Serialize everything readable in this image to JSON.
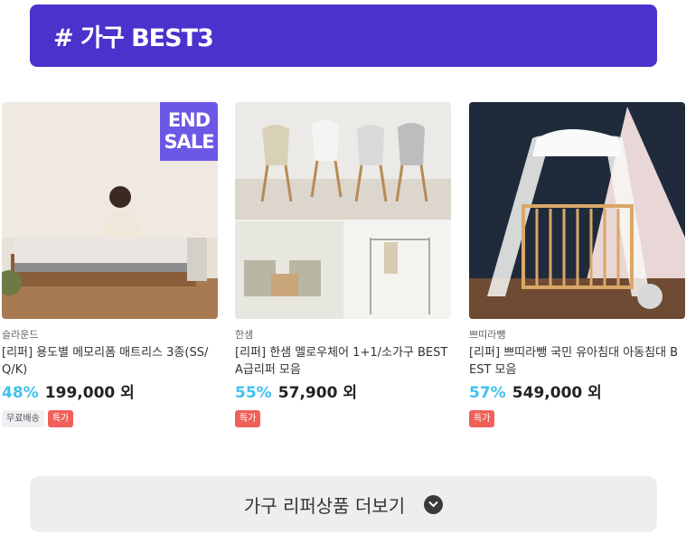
{
  "banner": {
    "title": "# 가구 BEST3"
  },
  "products": [
    {
      "seller": "슬라운드",
      "title": "[리퍼] 용도별 메모리폼 매트리스 3종(SS/Q/K)",
      "discount": "48%",
      "price": "199,000 외",
      "badge": [
        "END",
        "SALE"
      ],
      "tags": [
        "무료배송",
        "특가"
      ]
    },
    {
      "seller": "한샘",
      "title": "[리퍼] 한샘 멜로우체어 1+1/소가구 BEST A급리퍼 모음",
      "discount": "55%",
      "price": "57,900 외",
      "tags": [
        "특가"
      ]
    },
    {
      "seller": "쁘띠라뺑",
      "title": "[리퍼] 쁘띠라뺑 국민 유아침대 아동침대 BEST 모음",
      "discount": "57%",
      "price": "549,000 외",
      "tags": [
        "특가"
      ]
    }
  ],
  "more_button": {
    "label": "가구 리퍼상품 더보기",
    "icon": "chevron-down-icon"
  },
  "colors": {
    "banner": "#4a32cc",
    "discount": "#3fc1f0",
    "sale_tag": "#f0605a",
    "badge": "#6c58e6"
  }
}
